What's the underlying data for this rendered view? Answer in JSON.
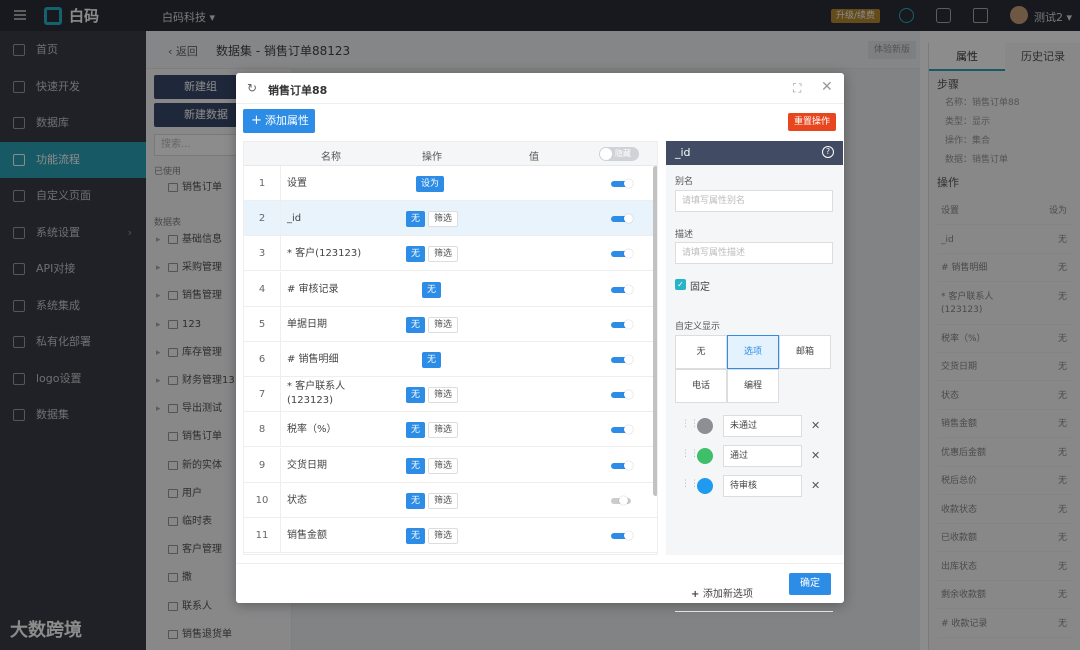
{
  "topbar": {
    "logo_text": "白码",
    "org": "白码科技 ▾",
    "upgrade": "升级/续费",
    "user": "测试2 ▾"
  },
  "sidebar": {
    "items": [
      {
        "label": "首页",
        "icon": "home-icon"
      },
      {
        "label": "快速开发",
        "icon": "cube-icon"
      },
      {
        "label": "数据库",
        "icon": "database-icon"
      },
      {
        "label": "功能流程",
        "icon": "flow-icon",
        "active": true
      },
      {
        "label": "自定义页面",
        "icon": "page-icon"
      },
      {
        "label": "系统设置",
        "icon": "monitor-icon",
        "arrow": "›"
      },
      {
        "label": "API对接",
        "icon": "api-icon"
      },
      {
        "label": "系统集成",
        "icon": "integration-icon"
      },
      {
        "label": "私有化部署",
        "icon": "server-icon"
      },
      {
        "label": "logo设置",
        "icon": "logo-icon"
      },
      {
        "label": "数据集",
        "icon": "dataset-icon"
      }
    ],
    "watermark": "大数跨境"
  },
  "subheader": {
    "back": "‹  返回",
    "title": "数据集 - 销售订单88123",
    "trial": "体验新版"
  },
  "leftpanel": {
    "btn1": "新建组",
    "btn2": "新建数据",
    "search_placeholder": "搜索...",
    "used_label": "已使用",
    "used_item": "销售订单",
    "tables_label": "数据表",
    "tree": [
      {
        "label": "基础信息",
        "folder": true
      },
      {
        "label": "采购管理",
        "folder": true
      },
      {
        "label": "销售管理",
        "folder": true
      },
      {
        "label": "123",
        "folder": true
      },
      {
        "label": "库存管理",
        "folder": true
      },
      {
        "label": "财务管理13",
        "folder": true
      },
      {
        "label": "导出测试",
        "folder": true
      },
      {
        "label": "销售订单",
        "folder": false
      },
      {
        "label": "新的实体",
        "folder": false
      },
      {
        "label": "用户",
        "folder": false
      },
      {
        "label": "临时表",
        "folder": false
      },
      {
        "label": "客户管理",
        "folder": false
      },
      {
        "label": "撒",
        "folder": false
      },
      {
        "label": "联系人",
        "folder": false
      },
      {
        "label": "销售退货单",
        "folder": false
      }
    ]
  },
  "rightpanel": {
    "tabs": [
      "属性",
      "历史记录"
    ],
    "step_label": "步骤",
    "step_kv": [
      "名称：销售订单88",
      "类型：显示",
      "操作：集合",
      "数据：销售订单"
    ],
    "ops_label": "操作",
    "ops_rows": [
      {
        "k": "设置",
        "v": "设为"
      },
      {
        "k": "_id",
        "v": "无"
      },
      {
        "k": "# 销售明细",
        "v": "无"
      },
      {
        "k": "* 客户联系人(123123)",
        "v": "无"
      },
      {
        "k": "税率（%）",
        "v": "无"
      },
      {
        "k": "交货日期",
        "v": "无"
      },
      {
        "k": "状态",
        "v": "无"
      },
      {
        "k": "销售金额",
        "v": "无"
      },
      {
        "k": "优惠后金额",
        "v": "无"
      },
      {
        "k": "税后总价",
        "v": "无"
      },
      {
        "k": "收款状态",
        "v": "无"
      },
      {
        "k": "已收款额",
        "v": "无"
      },
      {
        "k": "出库状态",
        "v": "无"
      },
      {
        "k": "剩余收款额",
        "v": "无"
      },
      {
        "k": "# 收款记录",
        "v": "无"
      }
    ]
  },
  "modal": {
    "title": "销售订单88",
    "add_property": "添加属性",
    "reset": "重置操作",
    "confirm": "确定",
    "table": {
      "headers": {
        "name": "名称",
        "op": "操作",
        "value": "值",
        "hide": "隐藏"
      },
      "rows": [
        {
          "num": "1",
          "name": "设置",
          "ops": [
            "设为"
          ],
          "on": true
        },
        {
          "num": "2",
          "name": "_id",
          "ops": [
            "无",
            "筛选"
          ],
          "on": true,
          "selected": true
        },
        {
          "num": "3",
          "name": "* 客户(123123)",
          "ops": [
            "无",
            "筛选"
          ],
          "on": true
        },
        {
          "num": "4",
          "name": "# 审核记录",
          "ops": [
            "无"
          ],
          "on": true
        },
        {
          "num": "5",
          "name": "单据日期",
          "ops": [
            "无",
            "筛选"
          ],
          "on": true
        },
        {
          "num": "6",
          "name": "# 销售明细",
          "ops": [
            "无"
          ],
          "on": true
        },
        {
          "num": "7",
          "name": "* 客户联系人(123123)",
          "ops": [
            "无",
            "筛选"
          ],
          "on": true
        },
        {
          "num": "8",
          "name": "税率（%）",
          "ops": [
            "无",
            "筛选"
          ],
          "on": true
        },
        {
          "num": "9",
          "name": "交货日期",
          "ops": [
            "无",
            "筛选"
          ],
          "on": true
        },
        {
          "num": "10",
          "name": "状态",
          "ops": [
            "无",
            "筛选"
          ],
          "on": false
        },
        {
          "num": "11",
          "name": "销售金额",
          "ops": [
            "无",
            "筛选"
          ],
          "on": true
        }
      ]
    },
    "detail": {
      "title": "_id",
      "alias_label": "别名",
      "alias_placeholder": "请填写属性别名",
      "desc_label": "描述",
      "desc_placeholder": "请填写属性描述",
      "fixed_label": "固定",
      "custom_label": "自定义显示",
      "segments": [
        "无",
        "选项",
        "邮箱",
        "电话",
        "编程"
      ],
      "active_segment": "选项",
      "options": [
        {
          "label": "未通过",
          "color": "#8c8f94"
        },
        {
          "label": "通过",
          "color": "#3fbf6a"
        },
        {
          "label": "待审核",
          "color": "#1e9bf0"
        }
      ],
      "add_option": "添加新选项"
    }
  },
  "colors": {
    "primary": "#2d8ce6",
    "accent": "#27b3c8",
    "danger": "#e8461e",
    "sidebar": "#393c45"
  }
}
